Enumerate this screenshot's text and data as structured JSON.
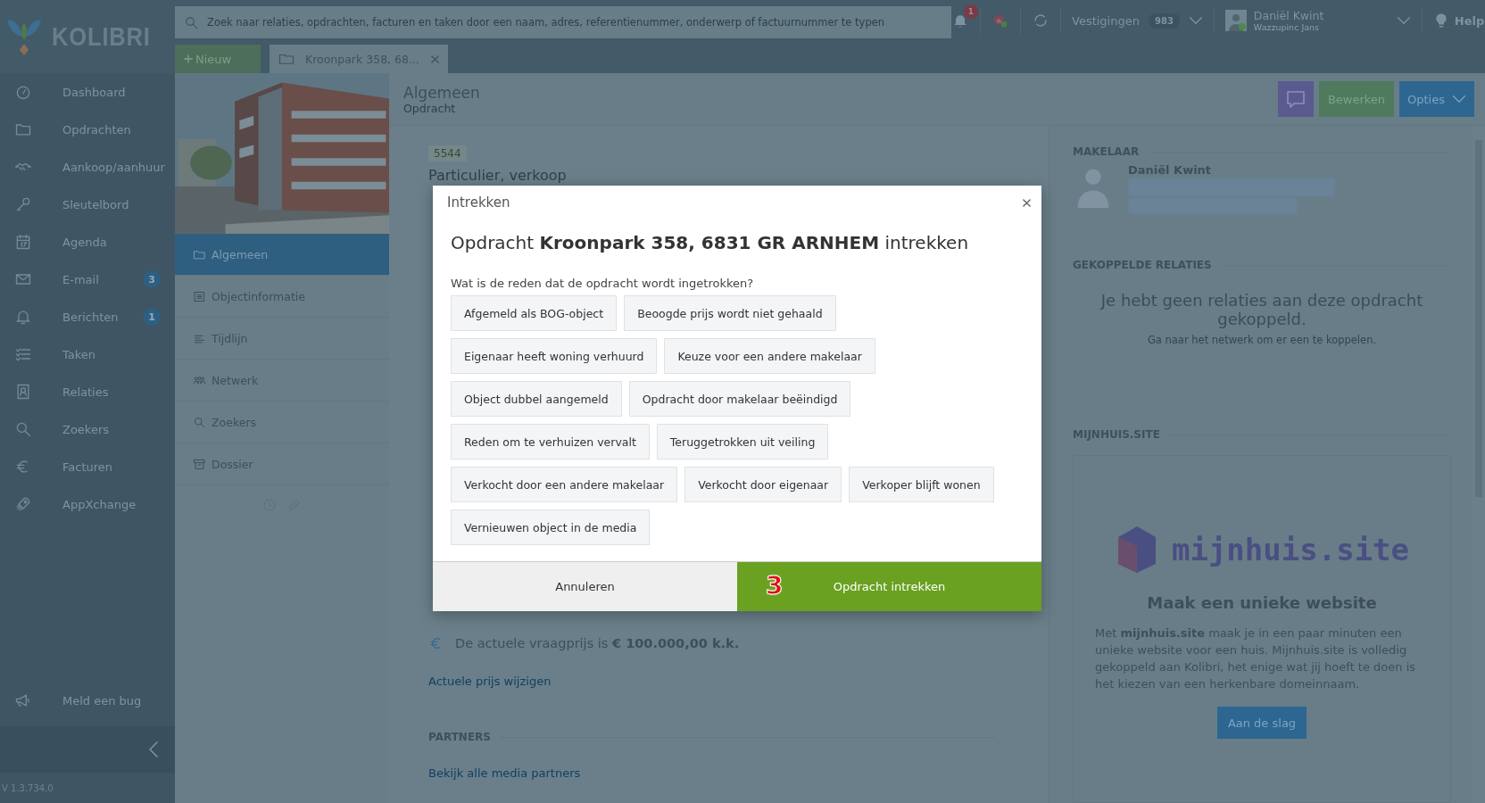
{
  "app": {
    "logo": "KOLIBRI",
    "version": "V 1.3.734.0"
  },
  "search": {
    "placeholder": "Zoek naar relaties, opdrachten, facturen en taken door een naam, adres, referentienummer, onderwerp of factuurnummer te typen"
  },
  "topbar": {
    "notifications_count": "1",
    "branches_label": "Vestigingen",
    "branches_count": "983",
    "user_name": "Daniël Kwint",
    "user_org": "Wazzupinc Jans",
    "help": "Help"
  },
  "tabs_bar": {
    "new_label": "Nieuw",
    "tabs": [
      {
        "label": "Kroonpark 358, 68...",
        "selected": true
      }
    ]
  },
  "sidebar": {
    "items": [
      {
        "label": "Dashboard"
      },
      {
        "label": "Opdrachten"
      },
      {
        "label": "Aankoop/aanhuur"
      },
      {
        "label": "Sleutelbord"
      },
      {
        "label": "Agenda"
      },
      {
        "label": "E-mail",
        "badge": "3"
      },
      {
        "label": "Berichten",
        "badge": "1"
      },
      {
        "label": "Taken"
      },
      {
        "label": "Relaties"
      },
      {
        "label": "Zoekers"
      },
      {
        "label": "Facturen"
      },
      {
        "label": "AppXchange"
      }
    ],
    "bug_report": "Meld een bug"
  },
  "object_menu": [
    {
      "label": "Algemeen",
      "selected": true
    },
    {
      "label": "Objectinformatie",
      "selected": false
    },
    {
      "label": "Tijdlijn",
      "selected": false
    },
    {
      "label": "Netwerk",
      "selected": false
    },
    {
      "label": "Zoekers",
      "selected": false
    },
    {
      "label": "Dossier",
      "selected": false
    }
  ],
  "page": {
    "title": "Algemeen",
    "subtitle": "Opdracht",
    "edit_button": "Bewerken",
    "options_button": "Opties"
  },
  "details": {
    "reference": "5544",
    "type": "Particulier, verkoop",
    "price_text": "De actuele vraagprijs is **€ 100.000,00 k.k.**",
    "price_link": "Actuele prijs wijzigen",
    "partners_heading": "PARTNERS",
    "partners_link": "Bekijk alle media partners"
  },
  "right": {
    "broker_heading": "MAKELAAR",
    "broker_name": "Daniël Kwint",
    "relations_heading": "GEKOPPELDE RELATIES",
    "relations_empty": "Je hebt geen relaties aan deze opdracht gekoppeld.",
    "relations_hint": "Ga naar het netwerk om er een te koppelen.",
    "site_heading": "MIJNHUIS.SITE",
    "site_logo": "mijnhuis.site",
    "site_title": "Maak een unieke website",
    "site_text": "Met **mijnhuis.site** maak je in een paar minuten een unieke website voor een huis. Mijnhuis.site is volledig gekoppeld aan Kolibri, het enige wat jij hoeft te doen is het kiezen van een herkenbare domeinnaam.",
    "site_button": "Aan de slag"
  },
  "modal": {
    "title": "Intrekken",
    "heading": "Opdracht **Kroonpark 358, 6831 GR ARNHEM** intrekken",
    "question": "Wat is de reden dat de opdracht wordt ingetrokken?",
    "reasons": [
      "Afgemeld als BOG-object",
      "Beoogde prijs wordt niet gehaald",
      "Eigenaar heeft woning verhuurd",
      "Keuze voor een andere makelaar",
      "Object dubbel aangemeld",
      "Opdracht door makelaar beëindigd",
      "Reden om te verhuizen vervalt",
      "Teruggetrokken uit veiling",
      "Verkocht door een andere makelaar",
      "Verkocht door eigenaar",
      "Verkoper blijft wonen",
      "Vernieuwen object in de media"
    ],
    "cancel": "Annuleren",
    "confirm": "Opdracht intrekken",
    "step_marker": "3"
  }
}
